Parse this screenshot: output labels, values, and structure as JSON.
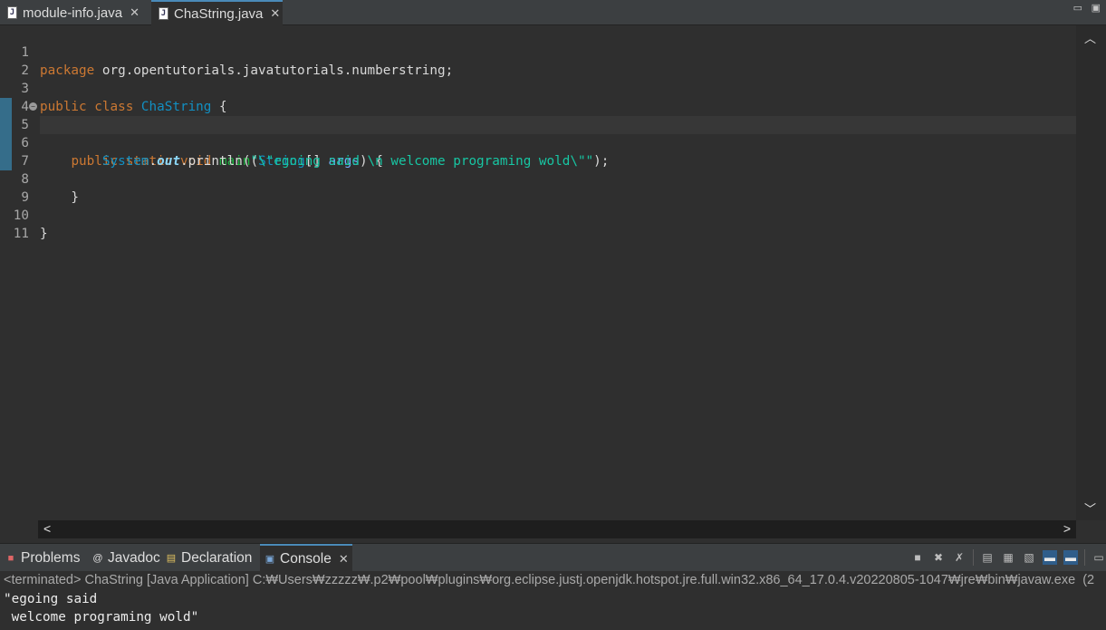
{
  "editor_tabs": [
    {
      "label": "module-info.java",
      "icon": "java-file-icon",
      "active": false
    },
    {
      "label": "ChaString.java",
      "icon": "java-file-icon",
      "active": true
    }
  ],
  "window_controls": {
    "minimize": "▭",
    "maximize": "▣"
  },
  "code_lines": [
    {
      "n": "1"
    },
    {
      "n": "2"
    },
    {
      "n": "3"
    },
    {
      "n": "4"
    },
    {
      "n": "5"
    },
    {
      "n": "6"
    },
    {
      "n": "7"
    },
    {
      "n": "8"
    },
    {
      "n": "9"
    },
    {
      "n": "10"
    },
    {
      "n": "11"
    }
  ],
  "code": {
    "l1_kw": "package",
    "l1_rest": " org.opentutorials.javatutorials.numberstring;",
    "l3_kw1": "public",
    "l3_kw2": "class",
    "l3_type": "ChaString",
    "l3_rest": " {",
    "l5_indent": "    ",
    "l5_kw1": "public",
    "l5_kw2": "static",
    "l5_kw3": "void",
    "l5_method": "main",
    "l5_p1": "(",
    "l5_type": "String",
    "l5_p2": "[] ",
    "l5_param": "args",
    "l5_p3": ") {",
    "l6_indent": "        ",
    "l6_type": "System",
    "l6_dot1": ".",
    "l6_field": "out",
    "l6_call": ".println(",
    "l6_str": "\"\\\"egoing said \\n welcome programing wold\\\"\"",
    "l6_end": ");",
    "l8": "    }",
    "l10": "}"
  },
  "view_tabs": [
    {
      "label": "Problems",
      "icon": "problems-icon"
    },
    {
      "label": "Javadoc",
      "icon": "javadoc-icon"
    },
    {
      "label": "Declaration",
      "icon": "declaration-icon"
    },
    {
      "label": "Console",
      "icon": "console-icon",
      "active": true
    }
  ],
  "console": {
    "status": "<terminated> ChaString [Java Application] C:₩Users₩zzzzz₩.p2₩pool₩plugins₩org.eclipse.justj.openjdk.hotspot.jre.full.win32.x86_64_17.0.4.v20220805-1047₩jre₩bin₩javaw.exe  (2",
    "output": [
      "\"egoing said",
      " welcome programing wold\""
    ]
  },
  "colors": {
    "accent": "#4a8ab8",
    "keyword": "#cc7832",
    "type": "#1290c3",
    "string": "#17c6a3",
    "method": "#1eb540"
  }
}
